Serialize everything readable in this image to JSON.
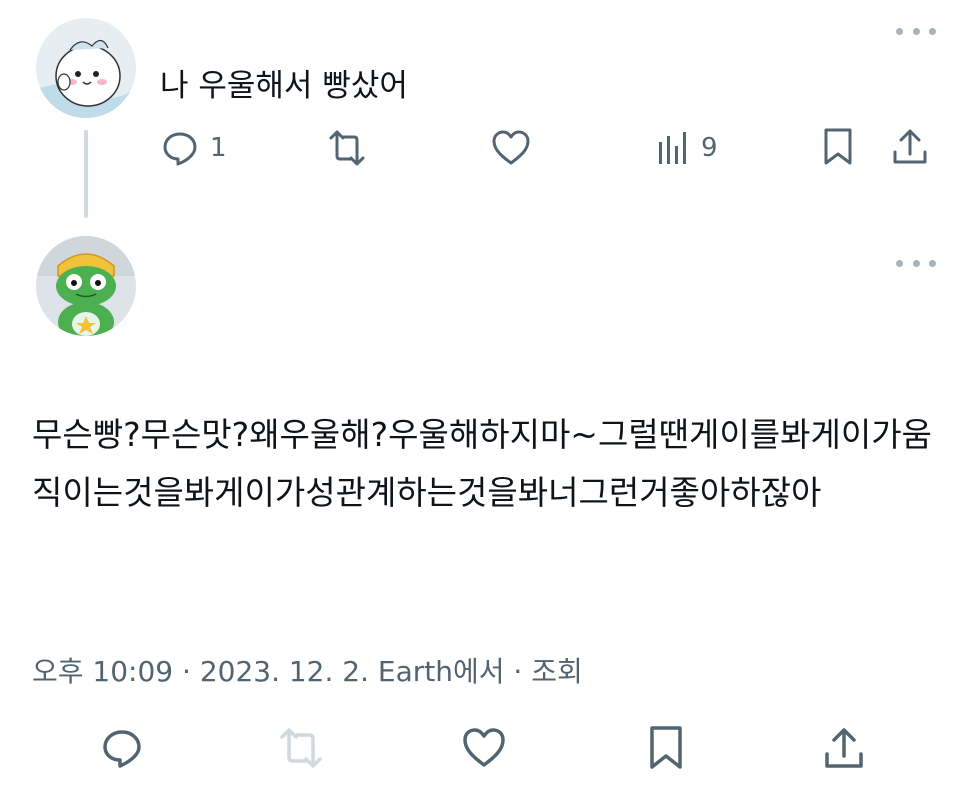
{
  "reply": {
    "text": "나 우울해서 빵샀어",
    "reply_count": "1",
    "view_count": "9"
  },
  "main_tweet": {
    "text": "무슨빵?무슨맛?왜우울해?우울해하지마~그럴땐게이를봐게이가움직이는것을봐게이가성관계하는것을봐너그런거좋아하잖아",
    "timestamp": "오후 10:09 · 2023. 12. 2. Earth에서 · 조회"
  },
  "icons": {
    "reply": "reply-icon",
    "retweet": "retweet-icon",
    "like": "like-icon",
    "views": "views-icon",
    "bookmark": "bookmark-icon",
    "share": "share-icon",
    "more": "more-icon"
  },
  "colors": {
    "icon_gray": "#536471",
    "retweet_disabled": "#cfd9de",
    "thread_line": "#cfd9de"
  }
}
